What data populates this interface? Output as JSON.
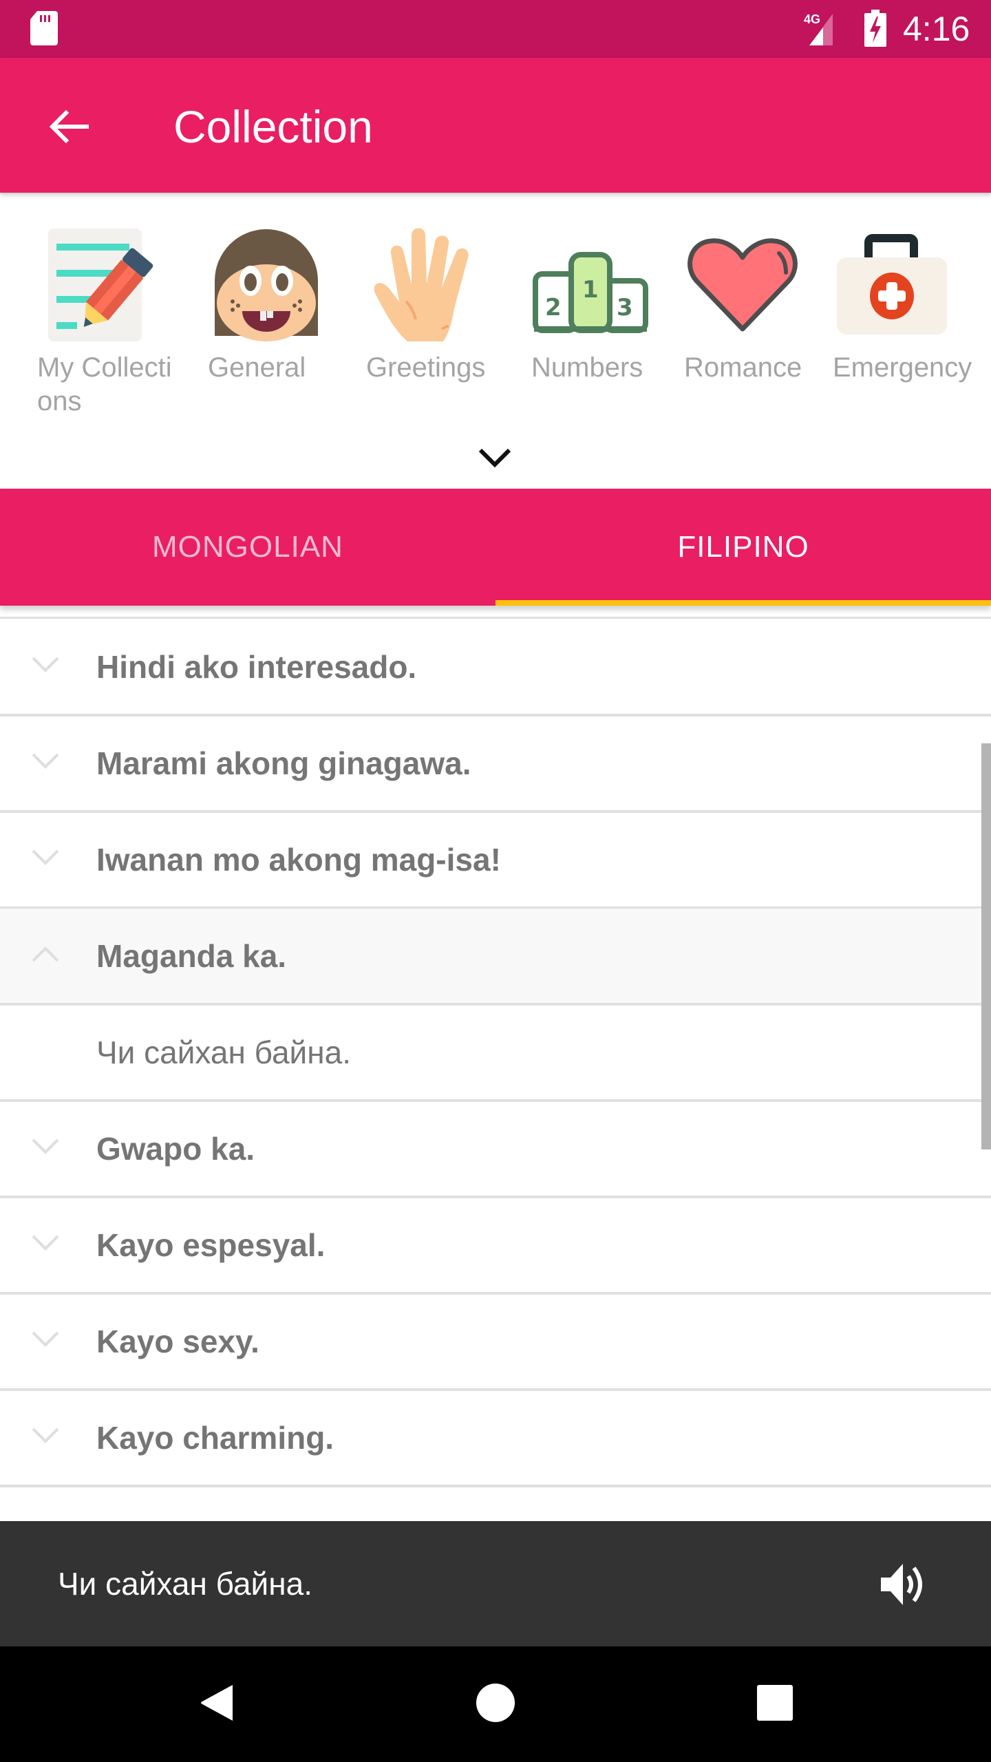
{
  "status_bar": {
    "time": "4:16",
    "network": "4G",
    "icons": [
      "sd-card-icon",
      "signal-4g-icon",
      "battery-charging-icon"
    ]
  },
  "app_bar": {
    "title": "Collection",
    "back_icon": "arrow-back-icon"
  },
  "categories": [
    {
      "label": "My Collections",
      "icon": "notepad-pencil-icon"
    },
    {
      "label": "General",
      "icon": "face-icon"
    },
    {
      "label": "Greetings",
      "icon": "waving-hand-icon"
    },
    {
      "label": "Numbers",
      "icon": "podium-icon"
    },
    {
      "label": "Romance",
      "icon": "heart-icon"
    },
    {
      "label": "Emergency",
      "icon": "first-aid-kit-icon"
    }
  ],
  "expand_icon": "chevron-down-icon",
  "tabs": [
    {
      "label": "MONGOLIAN",
      "active": false
    },
    {
      "label": "FILIPINO",
      "active": true
    }
  ],
  "phrases": [
    {
      "text": "Hindi ako interesado.",
      "expanded": false
    },
    {
      "text": "Marami akong ginagawa.",
      "expanded": false
    },
    {
      "text": "Iwanan mo akong mag-isa!",
      "expanded": false
    },
    {
      "text": "Maganda ka.",
      "expanded": true,
      "translation": "Чи сайхан байна."
    },
    {
      "text": "Gwapo ka.",
      "expanded": false
    },
    {
      "text": "Kayo espesyal.",
      "expanded": false
    },
    {
      "text": "Kayo sexy.",
      "expanded": false
    },
    {
      "text": "Kayo charming.",
      "expanded": false
    }
  ],
  "player": {
    "text": "Чи сайхан байна.",
    "icon": "speaker-icon"
  },
  "colors": {
    "status_bar": "#c2135d",
    "primary": "#e91e63",
    "tab_indicator": "#ffc107",
    "player_bg": "#333333"
  }
}
